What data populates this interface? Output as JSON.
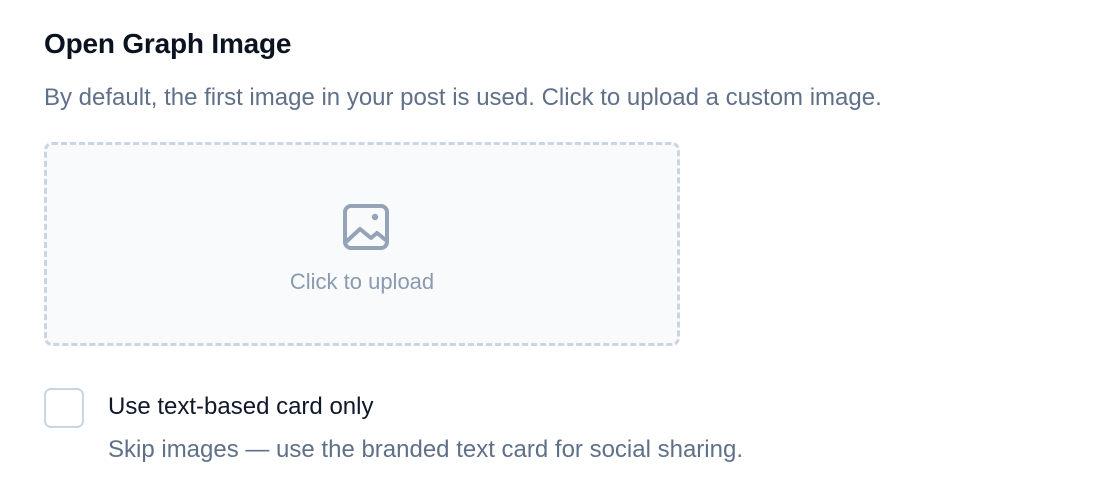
{
  "og_section": {
    "title": "Open Graph Image",
    "description": "By default, the first image in your post is used. Click to upload a custom image.",
    "upload": {
      "label": "Click to upload",
      "icon": "image-icon"
    }
  },
  "text_card_option": {
    "label": "Use text-based card only",
    "help": "Skip images — use the branded text card for social sharing.",
    "checked": false
  },
  "colors": {
    "title": "#0b1220",
    "muted_text": "#5f7088",
    "dropzone_border": "#cbd5e1",
    "dropzone_bg": "#f8fafc",
    "icon": "#8a9ab0"
  }
}
